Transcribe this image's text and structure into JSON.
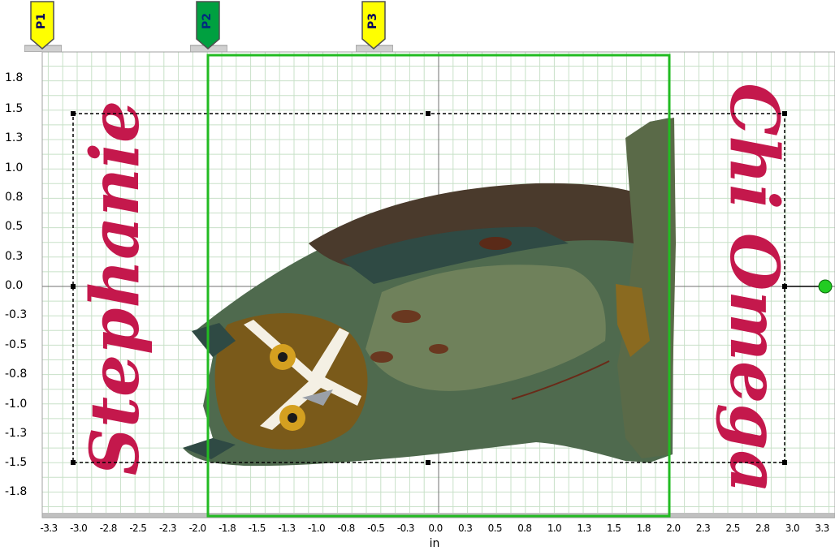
{
  "pages": [
    {
      "label": "P1",
      "color": "#ffff00",
      "text_color": "#2a2a80"
    },
    {
      "label": "P2",
      "color": "#00a040",
      "text_color": "#003a90"
    },
    {
      "label": "P3",
      "color": "#ffff00",
      "text_color": "#2a2a80"
    }
  ],
  "axis": {
    "y_ticks": [
      "1.8",
      "1.5",
      "1.3",
      "1.0",
      "0.8",
      "0.5",
      "0.3",
      "0.0",
      "-0.3",
      "-0.5",
      "-0.8",
      "-1.0",
      "-1.3",
      "-1.5",
      "-1.8"
    ],
    "x_ticks": [
      "-3.3",
      "-3.0",
      "-2.8",
      "-2.5",
      "-2.3",
      "-2.0",
      "-1.8",
      "-1.5",
      "-1.3",
      "-1.0",
      "-0.8",
      "-0.5",
      "-0.3",
      "0.0",
      "0.3",
      "0.5",
      "0.8",
      "1.0",
      "1.3",
      "1.5",
      "1.8",
      "2.0",
      "2.3",
      "2.5",
      "2.8",
      "3.0",
      "3.3"
    ],
    "units": "in"
  },
  "design": {
    "left_text": "Stephanie",
    "right_text": "Chi Omega",
    "text_color": "#c4184c",
    "hoop_color": "#22bb22",
    "grid_color": "#c8e0c8",
    "handle_color": "#22cc22"
  }
}
